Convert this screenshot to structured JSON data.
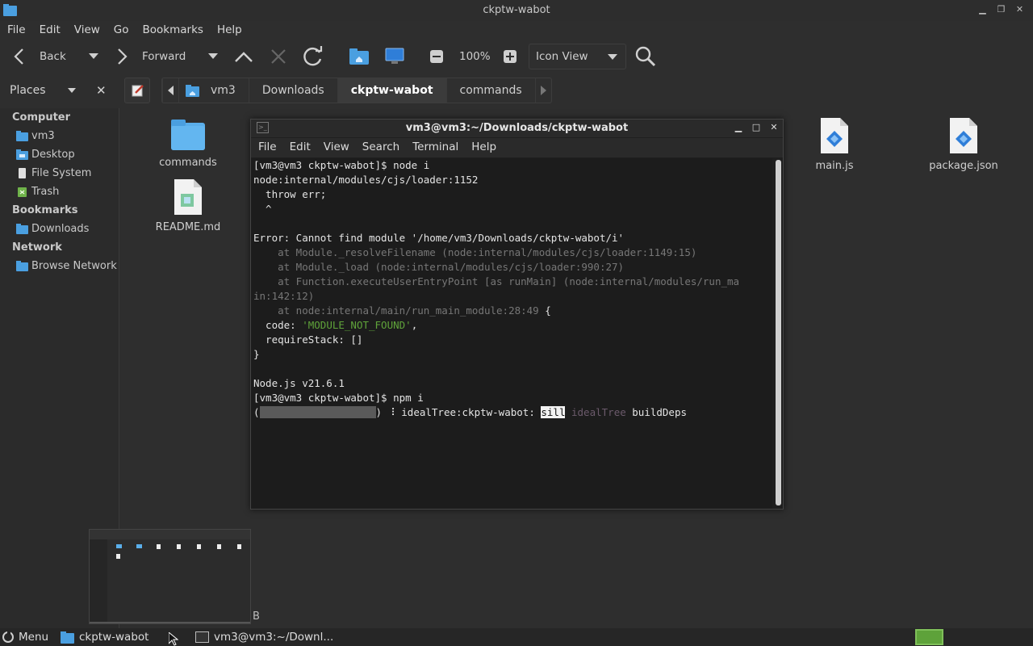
{
  "window": {
    "title": "ckptw-wabot"
  },
  "menubar": [
    "File",
    "Edit",
    "View",
    "Go",
    "Bookmarks",
    "Help"
  ],
  "toolbar": {
    "back": "Back",
    "forward": "Forward",
    "zoom": "100%",
    "view_mode": "Icon View"
  },
  "places": {
    "label": "Places"
  },
  "breadcrumb": [
    "vm3",
    "Downloads",
    "ckptw-wabot",
    "commands"
  ],
  "sidebar": {
    "computer_header": "Computer",
    "computer_items": [
      "vm3",
      "Desktop",
      "File System",
      "Trash"
    ],
    "bookmarks_header": "Bookmarks",
    "bookmark_items": [
      "Downloads"
    ],
    "network_header": "Network",
    "network_items": [
      "Browse Network"
    ]
  },
  "files": [
    {
      "name": "commands",
      "icon": "folder-icon"
    },
    {
      "name": "README.md",
      "icon": "markdown-file-icon"
    },
    {
      "name": "main.js",
      "icon": "javascript-file-icon"
    },
    {
      "name": "package.json",
      "icon": "json-file-icon"
    }
  ],
  "statusbar": {
    "text": "B"
  },
  "terminal": {
    "title": "vm3@vm3:~/Downloads/ckptw-wabot",
    "menu": [
      "File",
      "Edit",
      "View",
      "Search",
      "Terminal",
      "Help"
    ],
    "lines": {
      "l1": "[vm3@vm3 ckptw-wabot]$ node i",
      "l2": "node:internal/modules/cjs/loader:1152",
      "l3": "  throw err;",
      "l4": "  ^",
      "l5": "Error: Cannot find module '/home/vm3/Downloads/ckptw-wabot/i'",
      "l6": "    at Module._resolveFilename (node:internal/modules/cjs/loader:1149:15)",
      "l7": "    at Module._load (node:internal/modules/cjs/loader:990:27)",
      "l8": "    at Function.executeUserEntryPoint [as runMain] (node:internal/modules/run_ma",
      "l9": "in:142:12)",
      "l10": "    at node:internal/main/run_main_module:28:49",
      "l10b": " {",
      "l11a": "  code: ",
      "l11b": "'MODULE_NOT_FOUND'",
      "l11c": ",",
      "l12": "  requireStack: []",
      "l13": "}",
      "l14": "Node.js v21.6.1",
      "l15": "[vm3@vm3 ckptw-wabot]$ npm i",
      "l16a": "(",
      "l16b": ") ",
      "l16c": "⠸",
      "l16d": " idealTree:ckptw-wabot: ",
      "l16e": "sill",
      "l16f": " idealTree",
      "l16g": " buildDeps"
    }
  },
  "taskbar": {
    "menu": "Menu",
    "tasks": [
      "ckptw-wabot",
      "vm3@vm3:~/Downl..."
    ]
  },
  "colors": {
    "folder": "#4a9fe0",
    "accent_green": "#5ea23a"
  }
}
